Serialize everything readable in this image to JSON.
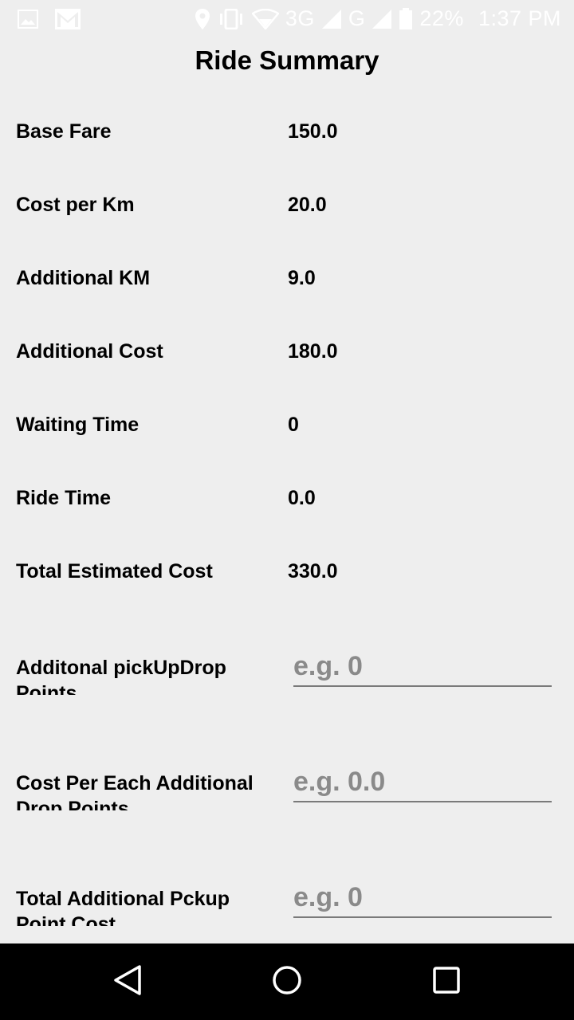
{
  "status_bar": {
    "network_3g": "3G",
    "network_g": "G",
    "battery": "22%",
    "time": "1:37 PM",
    "icons": [
      "image-icon",
      "gmail-icon",
      "location-icon",
      "vibrate-icon",
      "wifi-icon",
      "signal-icon",
      "battery-icon"
    ]
  },
  "title": "Ride Summary",
  "rows": [
    {
      "label": "Base Fare",
      "value": "150.0"
    },
    {
      "label": "Cost per Km",
      "value": "20.0"
    },
    {
      "label": "Additional KM",
      "value": "9.0"
    },
    {
      "label": "Additional Cost",
      "value": "180.0"
    },
    {
      "label": "Waiting Time",
      "value": "0"
    },
    {
      "label": "Ride Time",
      "value": "0.0"
    },
    {
      "label": "Total Estimated Cost",
      "value": "330.0"
    }
  ],
  "fields": [
    {
      "label": "Additonal pickUpDrop Points",
      "placeholder": "e.g. 0",
      "value": ""
    },
    {
      "label": "Cost Per Each Additional Drop Points",
      "placeholder": "e.g. 0.0",
      "value": ""
    },
    {
      "label": "Total Additional Pckup Point Cost",
      "placeholder": "e.g. 0",
      "value": ""
    }
  ],
  "nav": {
    "icons": [
      "back-icon",
      "home-icon",
      "recents-icon"
    ]
  },
  "colors": {
    "background": "#eeeeee",
    "nav_bar": "#000000",
    "placeholder": "#8a8a8a",
    "underline": "#7a7a7a"
  }
}
